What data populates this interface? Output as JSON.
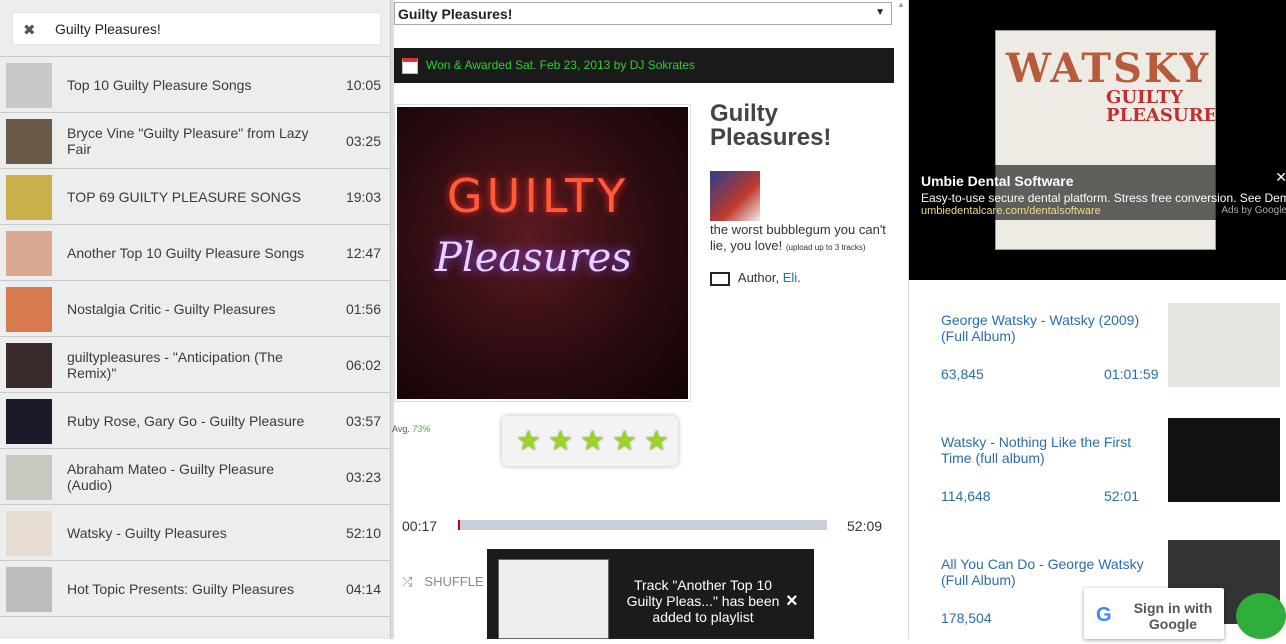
{
  "search": {
    "query": "Guilty Pleasures!",
    "clear_icon": "close-icon"
  },
  "tracks": [
    {
      "title": "Top 10 Guilty Pleasure Songs",
      "duration": "10:05"
    },
    {
      "title": "Bryce Vine \"Guilty Pleasure\" from Lazy Fair",
      "duration": "03:25"
    },
    {
      "title": "TOP 69 GUILTY PLEASURE SONGS",
      "duration": "19:03"
    },
    {
      "title": "Another Top 10 Guilty Pleasure Songs",
      "duration": "12:47"
    },
    {
      "title": "Nostalgia Critic - Guilty Pleasures",
      "duration": "01:56"
    },
    {
      "title": "guiltypleasures - \"Anticipation (The Remix)\"",
      "duration": "06:02"
    },
    {
      "title": "Ruby Rose, Gary Go - Guilty Pleasure",
      "duration": "03:57"
    },
    {
      "title": "Abraham Mateo - Guilty Pleasure (Audio)",
      "duration": "03:23"
    },
    {
      "title": "Watsky - Guilty Pleasures",
      "duration": "52:10"
    },
    {
      "title": "Hot Topic Presents: Guilty Pleasures",
      "duration": "04:14"
    }
  ],
  "playlist": {
    "select_value": "Guilty Pleasures!",
    "award": "Won & Awarded Sat. Feb 23, 2013 by DJ Sokrates",
    "title": "Guilty Pleasures!",
    "description": "the worst bubblegum you can't lie, you love!",
    "upload_note": "(upload up to 3 tracks)",
    "author_label": "Author,",
    "author_name": "Eli",
    "author_suffix": ".",
    "avg_label": "Avg.",
    "avg_value": "73%",
    "rating_stars": 5,
    "cover_text_1": "GUILTY",
    "cover_text_2": "Pleasures"
  },
  "player": {
    "current": "00:17",
    "total": "52:09",
    "progress": 0.005,
    "shuffle_label": "SHUFFLE"
  },
  "toast": {
    "message": "Track \"Another Top 10 Guilty Pleas...\" has been added to playlist",
    "close": "×"
  },
  "ad": {
    "image_text_1": "WATSKY",
    "image_text_2": "GUILTY PLEASURES",
    "title": "Umbie Dental Software",
    "desc": "Easy-to-use secure dental platform. Stress free conversion. See Demo",
    "url": "umbiedentalcare.com/dentalsoftware",
    "by": "Ads by Google"
  },
  "related": [
    {
      "title": "George Watsky - Watsky (2009) (Full Album)",
      "views": "63,845",
      "duration": "01:01:59"
    },
    {
      "title": "Watsky - Nothing Like the First Time (full album)",
      "views": "114,648",
      "duration": "52:01"
    },
    {
      "title": "All You Can Do - George Watsky (Full Album)",
      "views": "178,504",
      "duration": ""
    }
  ],
  "google_signin": {
    "label": "Sign in with Google"
  },
  "colors": {
    "award_green": "#2dd02d",
    "link_blue": "#2b6cb0",
    "progress_red": "#cc0000"
  }
}
